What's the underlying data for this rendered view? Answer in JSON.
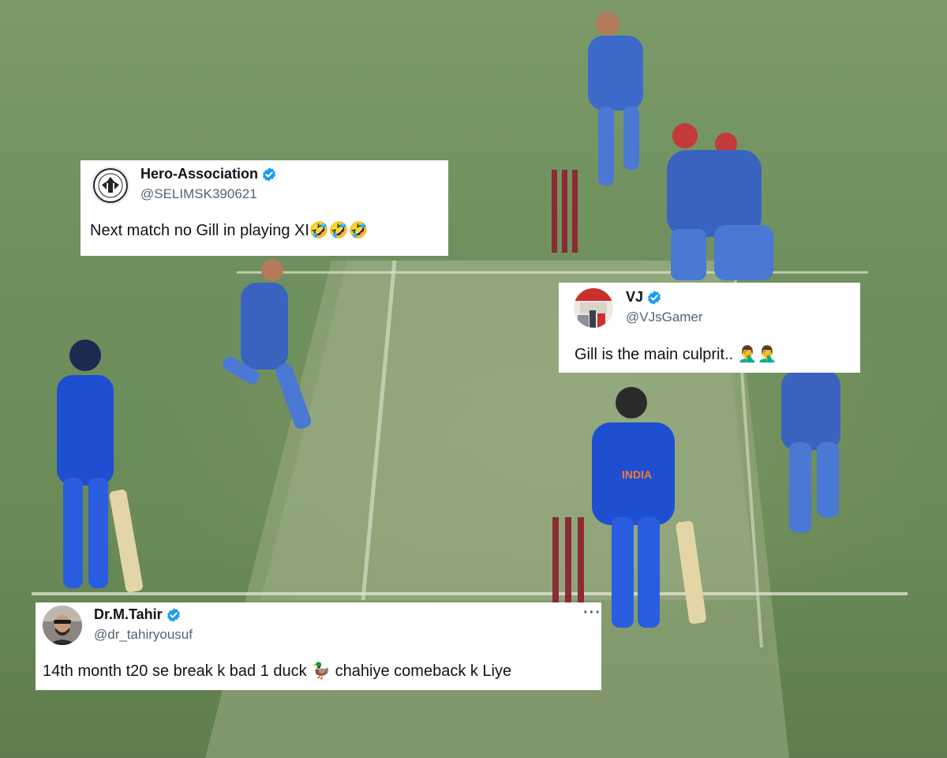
{
  "colors": {
    "verified_blue": "#1d9bf0",
    "handle_grey": "#536471",
    "text": "#0f1419",
    "pitch": "#8fa27a",
    "grass": "#6f8f5f"
  },
  "background": {
    "description_icon": "cricket-field-photo"
  },
  "tweets": [
    {
      "name": "Hero-Association",
      "handle": "@SELIMSK390621",
      "text": "Next match no Gill in playing XI🤣🤣🤣",
      "verified": true,
      "avatar_icon": "association-logo-icon"
    },
    {
      "name": "VJ",
      "handle": "@VJsGamer",
      "text": "Gill is the main culprit.. 🤦‍♂️🤦‍♂️",
      "verified": true,
      "avatar_icon": "gamer-avatar-icon"
    },
    {
      "name": "Dr.M.Tahir",
      "handle": "@dr_tahiryousuf",
      "text": "14th month t20 se break k bad 1 duck 🦆 chahiye comeback k Liye",
      "verified": true,
      "more_icon": "more-options-icon",
      "avatar_icon": "profile-photo-icon"
    }
  ]
}
